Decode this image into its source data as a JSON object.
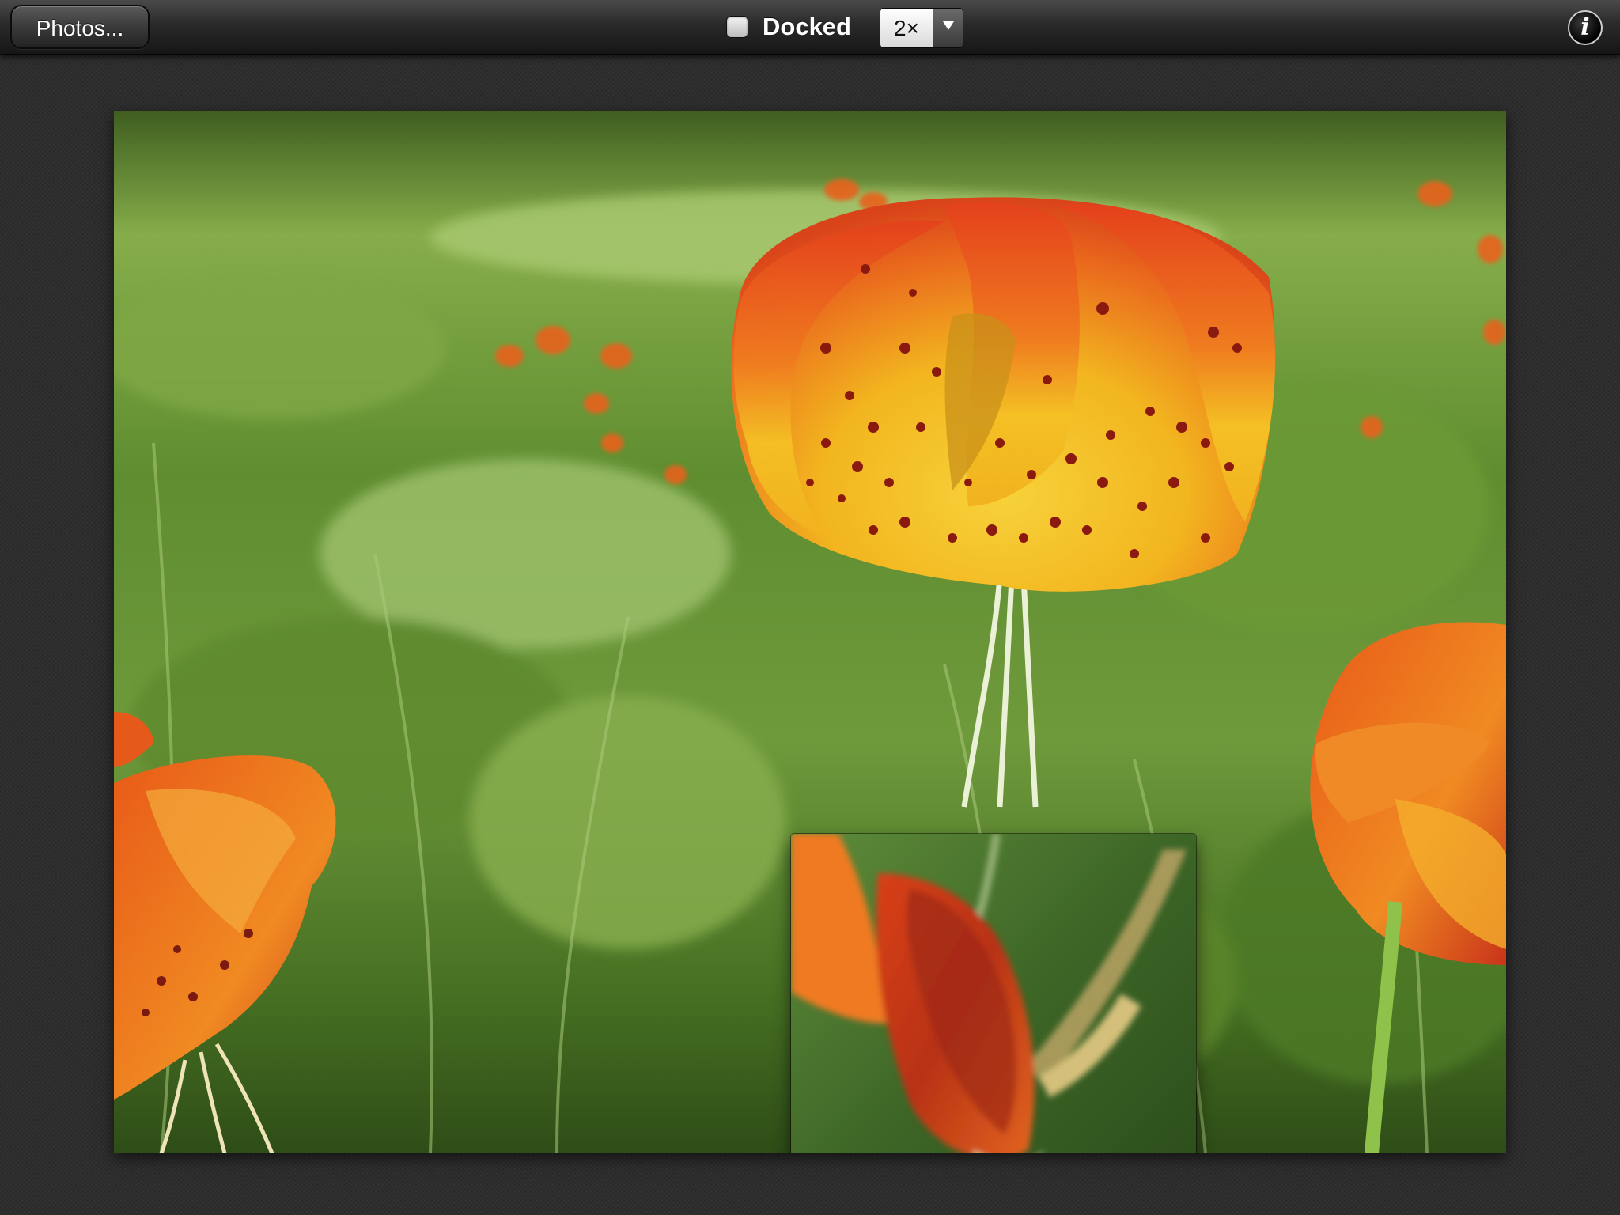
{
  "toolbar": {
    "photos_button_label": "Photos...",
    "docked_label": "Docked",
    "docked_checked": false,
    "zoom_value": "2×",
    "info_label": "i"
  },
  "icons": {
    "checkbox": "checkbox-icon",
    "dropdown": "chevron-down-icon",
    "info": "info-icon"
  },
  "colors": {
    "toolbar_top": "#4a4a4a",
    "toolbar_bottom": "#161616",
    "background": "#2b2b2b",
    "grass": "#4d7a2a",
    "petal_orange": "#e8571a",
    "petal_yellow": "#f5c61f",
    "spot": "#8a1a10"
  }
}
